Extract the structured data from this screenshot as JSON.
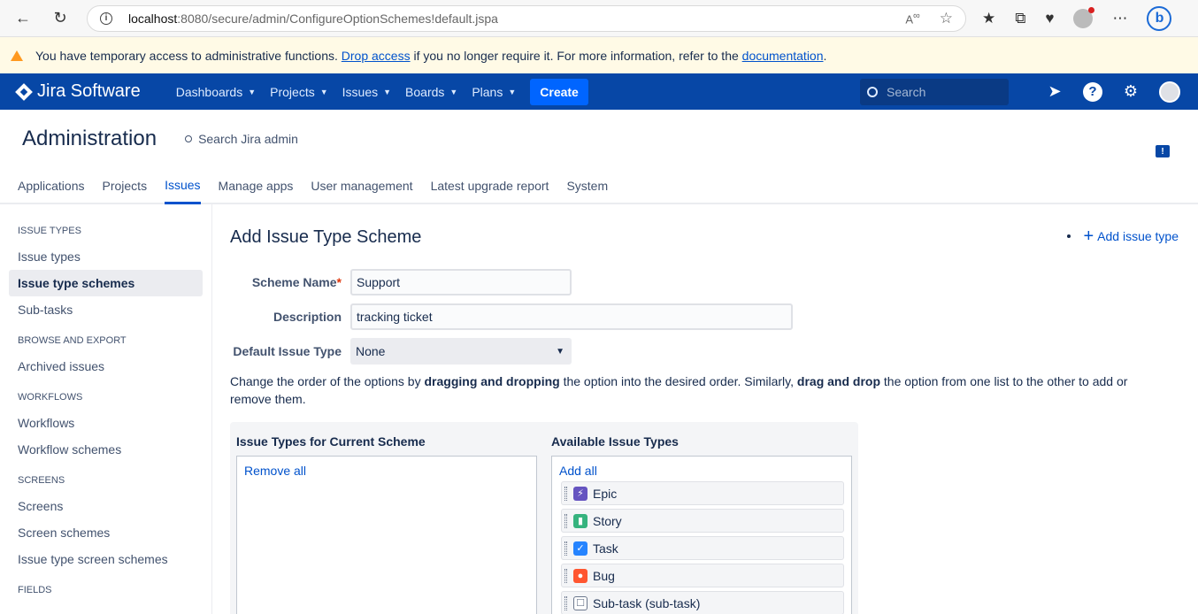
{
  "browser": {
    "url_host": "localhost",
    "url_path": ":8080/secure/admin/ConfigureOptionSchemes!default.jspa",
    "reader_label": "A⁰"
  },
  "banner": {
    "text_before": "You have temporary access to administrative functions.",
    "drop_link": "Drop access",
    "text_middle": "if you no longer require it. For more information, refer to the",
    "doc_link": "documentation",
    "text_after": "."
  },
  "jira": {
    "product": "Jira Software",
    "menu": [
      "Dashboards",
      "Projects",
      "Issues",
      "Boards",
      "Plans"
    ],
    "create": "Create",
    "search_placeholder": "Search"
  },
  "admin": {
    "title": "Administration",
    "search": "Search Jira admin",
    "tabs": [
      "Applications",
      "Projects",
      "Issues",
      "Manage apps",
      "User management",
      "Latest upgrade report",
      "System"
    ],
    "active_tab": "Issues"
  },
  "sidebar": {
    "groups": [
      {
        "heading": "ISSUE TYPES",
        "items": [
          "Issue types",
          "Issue type schemes",
          "Sub-tasks"
        ]
      },
      {
        "heading": "BROWSE AND EXPORT",
        "items": [
          "Archived issues"
        ]
      },
      {
        "heading": "WORKFLOWS",
        "items": [
          "Workflows",
          "Workflow schemes"
        ]
      },
      {
        "heading": "SCREENS",
        "items": [
          "Screens",
          "Screen schemes",
          "Issue type screen schemes"
        ]
      },
      {
        "heading": "FIELDS",
        "items": []
      }
    ],
    "active_item": "Issue type schemes"
  },
  "form": {
    "title": "Add Issue Type Scheme",
    "add_issue_type": "Add issue type",
    "scheme_name_label": "Scheme Name",
    "scheme_name_value": "Support",
    "description_label": "Description",
    "description_value": "tracking ticket",
    "default_type_label": "Default Issue Type",
    "default_type_value": "None",
    "hint_1": "Change the order of the options by",
    "hint_b1": "dragging and dropping",
    "hint_2": "the option into the desired order. Similarly,",
    "hint_b2": "drag and drop",
    "hint_3": "the option from one list to the other to add or remove them."
  },
  "lists": {
    "current_title": "Issue Types for Current Scheme",
    "remove_all": "Remove all",
    "available_title": "Available Issue Types",
    "add_all": "Add all",
    "available": [
      {
        "label": "Epic",
        "color": "#6554c0",
        "glyph": "⚡"
      },
      {
        "label": "Story",
        "color": "#36b37e",
        "glyph": "▮"
      },
      {
        "label": "Task",
        "color": "#2684ff",
        "glyph": "✓"
      },
      {
        "label": "Bug",
        "color": "#ff5630",
        "glyph": "●"
      },
      {
        "label": "Sub-task (sub-task)",
        "color": "#ffffff",
        "glyph": "☐"
      }
    ]
  }
}
